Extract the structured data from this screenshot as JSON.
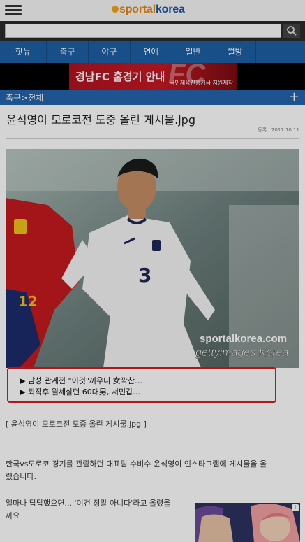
{
  "header": {
    "logo_sport": "sportal",
    "logo_korea": "korea"
  },
  "search": {
    "placeholder": ""
  },
  "nav": {
    "items": [
      "핫뉴",
      "축구",
      "야구",
      "연예",
      "일반",
      "썰방"
    ]
  },
  "banner": {
    "title": "경남FC 홈경기 안내",
    "subtitle": "국민체육진흥기금 지원제작"
  },
  "section": {
    "breadcrumb": "축구>전체",
    "plus": "+"
  },
  "article": {
    "title": "윤석영이 모로코전 도중 올린 게시물.jpg",
    "date": "등록 : 2017.10.11",
    "photo_watermark_1": "sportalkorea.com",
    "photo_watermark_2": "gettyimages Korea",
    "player_number": "3",
    "opponent_number": "12",
    "caption": "[ 윤석영이 모로코전 도중 올린 게시물.jpg ]",
    "paragraph1_line1": "한국vs모로코 경기를 관람하던 대표팀 수비수 윤석영이 인스타그램에 게시물을 올",
    "paragraph1_line2": "렸습니다.",
    "paragraph2_line1": "얼마나 답답했으면... '이건 정말 아니다'라고 올렸을",
    "paragraph2_line2": "까요"
  },
  "headlines": {
    "item1": "▶ 남성 관계전 \"이것\"끼우니 女깍찬…",
    "item2": "▶ 퇴직후 월세살던 60대男, 서민갑…"
  },
  "colors": {
    "nav_blue": "#1f5fa5",
    "section_blue": "#2364ab",
    "headline_border": "#d71c1c",
    "logo_orange": "#e48a15"
  }
}
